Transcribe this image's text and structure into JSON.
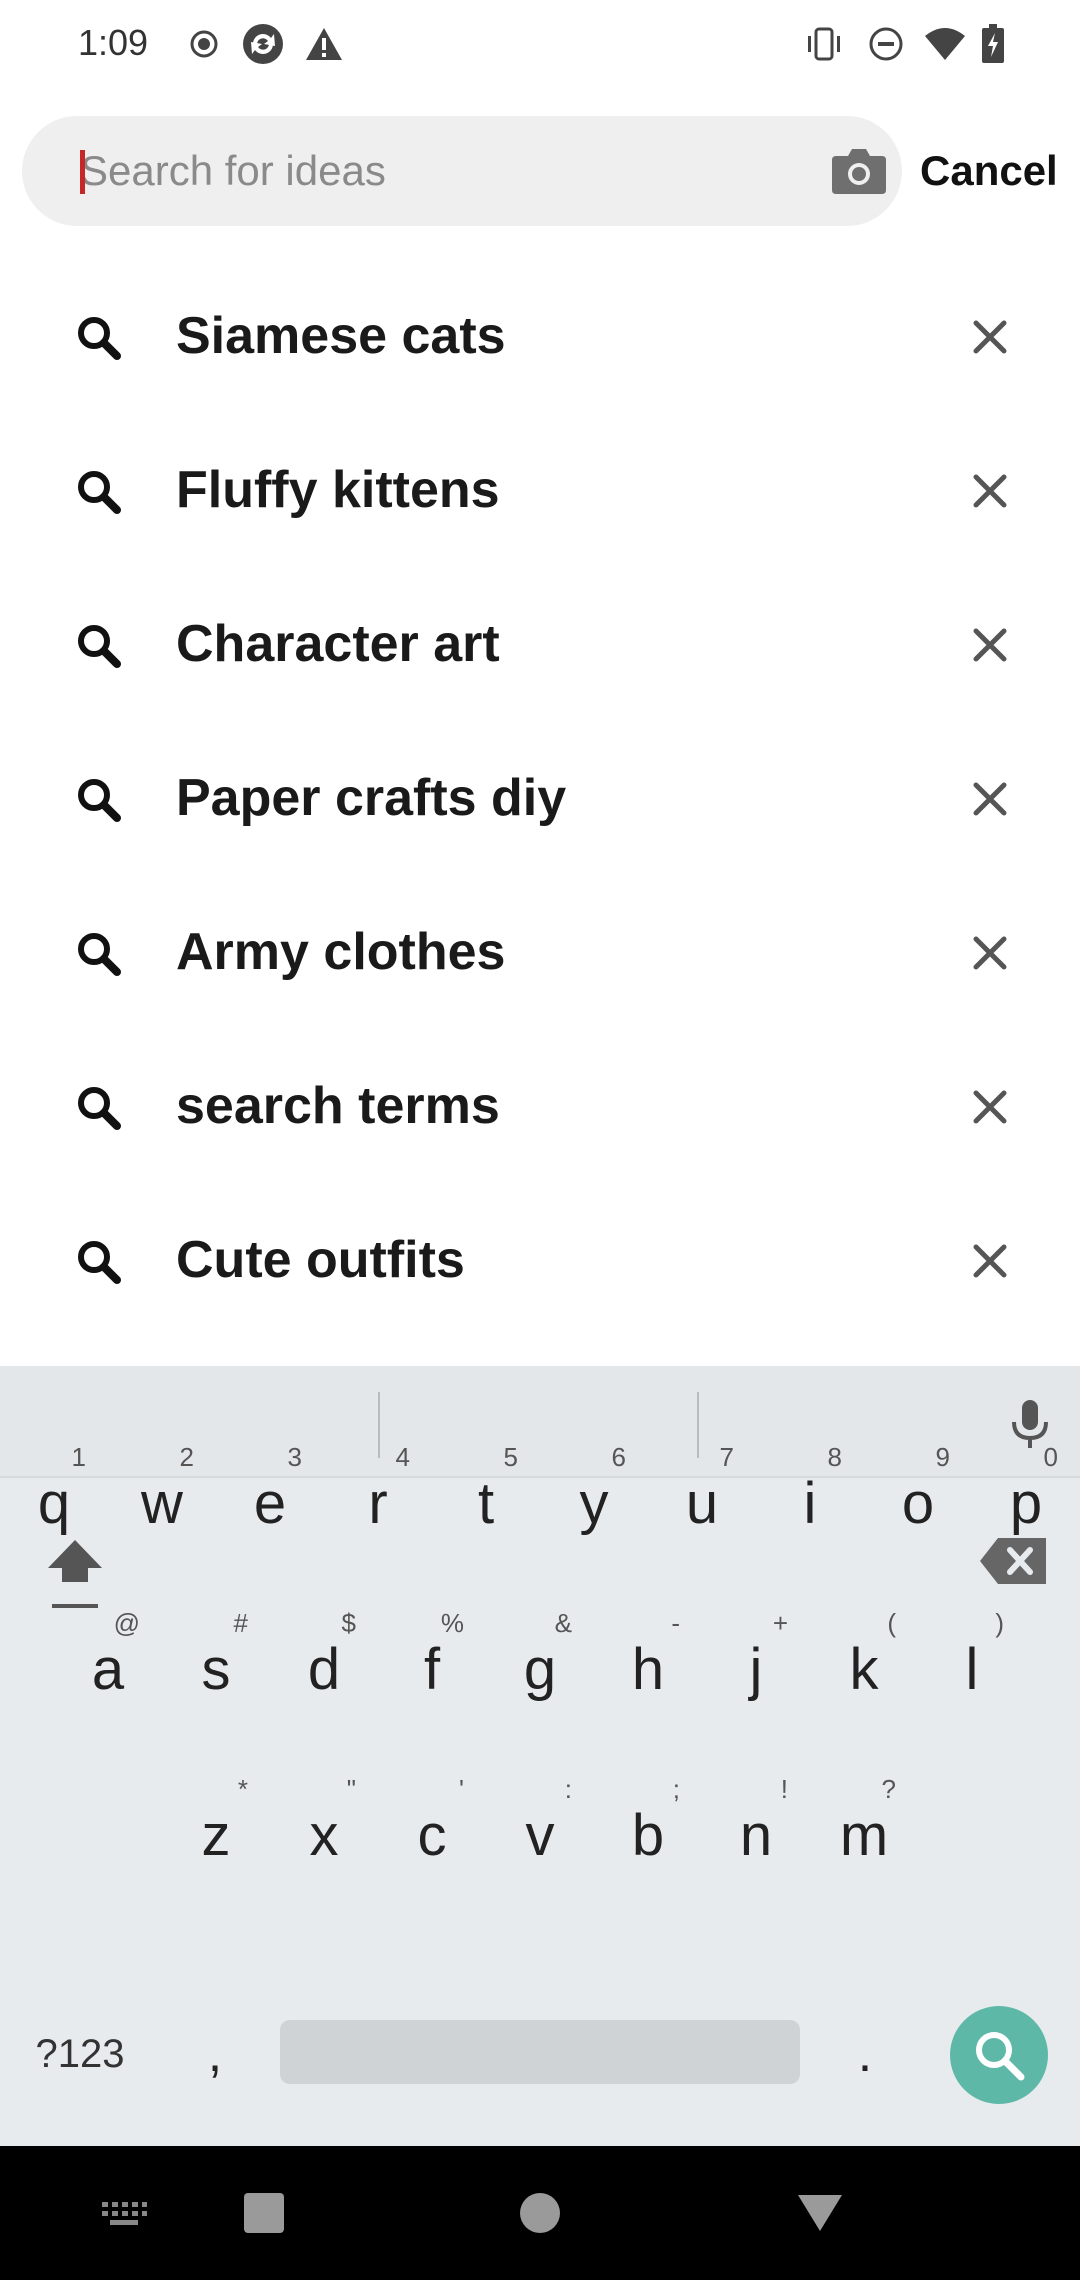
{
  "status_bar": {
    "time": "1:09",
    "left_icons": [
      "record-icon",
      "sync-icon",
      "warning-icon"
    ],
    "right_icons": [
      "vibrate-icon",
      "dnd-icon",
      "wifi-icon",
      "battery-charging-icon"
    ]
  },
  "search": {
    "placeholder": "Search for ideas",
    "value": "",
    "camera_icon": "camera-icon",
    "cancel_label": "Cancel"
  },
  "recent_searches": [
    {
      "label": "Siamese cats"
    },
    {
      "label": "Fluffy kittens"
    },
    {
      "label": "Character art"
    },
    {
      "label": "Paper crafts diy"
    },
    {
      "label": "Army clothes"
    },
    {
      "label": "search terms"
    },
    {
      "label": "Cute outfits"
    }
  ],
  "keyboard": {
    "row1": [
      {
        "key": "q",
        "sub": "1"
      },
      {
        "key": "w",
        "sub": "2"
      },
      {
        "key": "e",
        "sub": "3"
      },
      {
        "key": "r",
        "sub": "4"
      },
      {
        "key": "t",
        "sub": "5"
      },
      {
        "key": "y",
        "sub": "6"
      },
      {
        "key": "u",
        "sub": "7"
      },
      {
        "key": "i",
        "sub": "8"
      },
      {
        "key": "o",
        "sub": "9"
      },
      {
        "key": "p",
        "sub": "0"
      }
    ],
    "row2": [
      {
        "key": "a",
        "sub": "@"
      },
      {
        "key": "s",
        "sub": "#"
      },
      {
        "key": "d",
        "sub": "$"
      },
      {
        "key": "f",
        "sub": "%"
      },
      {
        "key": "g",
        "sub": "&"
      },
      {
        "key": "h",
        "sub": "-"
      },
      {
        "key": "j",
        "sub": "+"
      },
      {
        "key": "k",
        "sub": "("
      },
      {
        "key": "l",
        "sub": ")"
      }
    ],
    "row3": [
      {
        "key": "z",
        "sub": "*"
      },
      {
        "key": "x",
        "sub": "\""
      },
      {
        "key": "c",
        "sub": "'"
      },
      {
        "key": "v",
        "sub": ":"
      },
      {
        "key": "b",
        "sub": ";"
      },
      {
        "key": "n",
        "sub": "!"
      },
      {
        "key": "m",
        "sub": "?"
      }
    ],
    "symbols_label": "?123",
    "comma": ",",
    "period": ".",
    "accent_color": "#5eb8a8"
  },
  "nav_bar": {
    "icons": [
      "keyboard-switch-icon",
      "recents-icon",
      "home-icon",
      "back-icon"
    ]
  }
}
